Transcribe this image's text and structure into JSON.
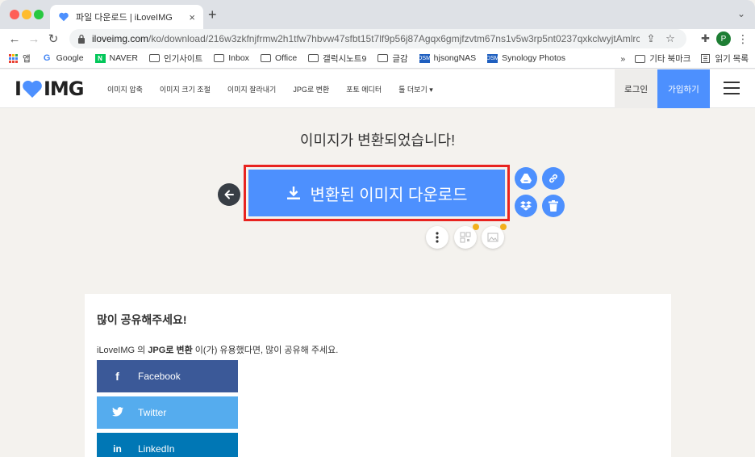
{
  "browser": {
    "tab_title": "파일 다운로드 | iLoveIMG",
    "tab_close": "×",
    "new_tab": "+",
    "url_host": "iloveimg.com",
    "url_path": "/ko/download/216w3zkfnjfrmw2h1tfw7hbvw47sfbt15t7lf9p56j87Agqx6gmjfzvtm67ns1v5w3rp5nt0237qxkclwyjtAmlrc...",
    "profile_initial": "P",
    "bookmarks": [
      {
        "label": "앱",
        "icon": "apps-grid-icon"
      },
      {
        "label": "Google",
        "icon": "google-icon"
      },
      {
        "label": "NAVER",
        "icon": "naver-icon"
      },
      {
        "label": "인기사이트",
        "icon": "folder-icon"
      },
      {
        "label": "Inbox",
        "icon": "folder-icon"
      },
      {
        "label": "Office",
        "icon": "folder-icon"
      },
      {
        "label": "갤럭시노트9",
        "icon": "folder-icon"
      },
      {
        "label": "글감",
        "icon": "folder-icon"
      },
      {
        "label": "hjsongNAS",
        "icon": "dsm-icon"
      },
      {
        "label": "Synology Photos",
        "icon": "dsm-icon"
      }
    ],
    "bookmarks_overflow": "»",
    "other_bookmarks": "기타 북마크",
    "reading_list": "읽기 목록"
  },
  "site": {
    "logo_left": "I",
    "logo_right": "IMG",
    "nav": [
      "이미지 압축",
      "이미지 크기 조절",
      "이미지 잘라내기",
      "JPG로 변환",
      "포토 에디터",
      "툴 더보기 ▾"
    ],
    "login": "로그인",
    "signup": "가입하기"
  },
  "main": {
    "headline": "이미지가 변환되었습니다!",
    "download_label": "변환된 이미지 다운로드"
  },
  "share": {
    "title": "많이 공유해주세요!",
    "desc_prefix": "iLoveIMG 의 ",
    "desc_tool": "JPG로 변환",
    "desc_suffix": " 이(가) 유용했다면, 많이 공유해 주세요.",
    "buttons": [
      {
        "icon_glyph": "f",
        "label": "Facebook"
      },
      {
        "icon_glyph": "🐦",
        "label": "Twitter"
      },
      {
        "icon_glyph": "in",
        "label": "LinkedIn"
      }
    ]
  },
  "colors": {
    "brand_blue": "#4d90fe",
    "highlight_red": "#e8231f",
    "facebook": "#3b5998",
    "twitter": "#55acee",
    "linkedin": "#0077b5",
    "badge_yellow": "#f2b01e"
  }
}
